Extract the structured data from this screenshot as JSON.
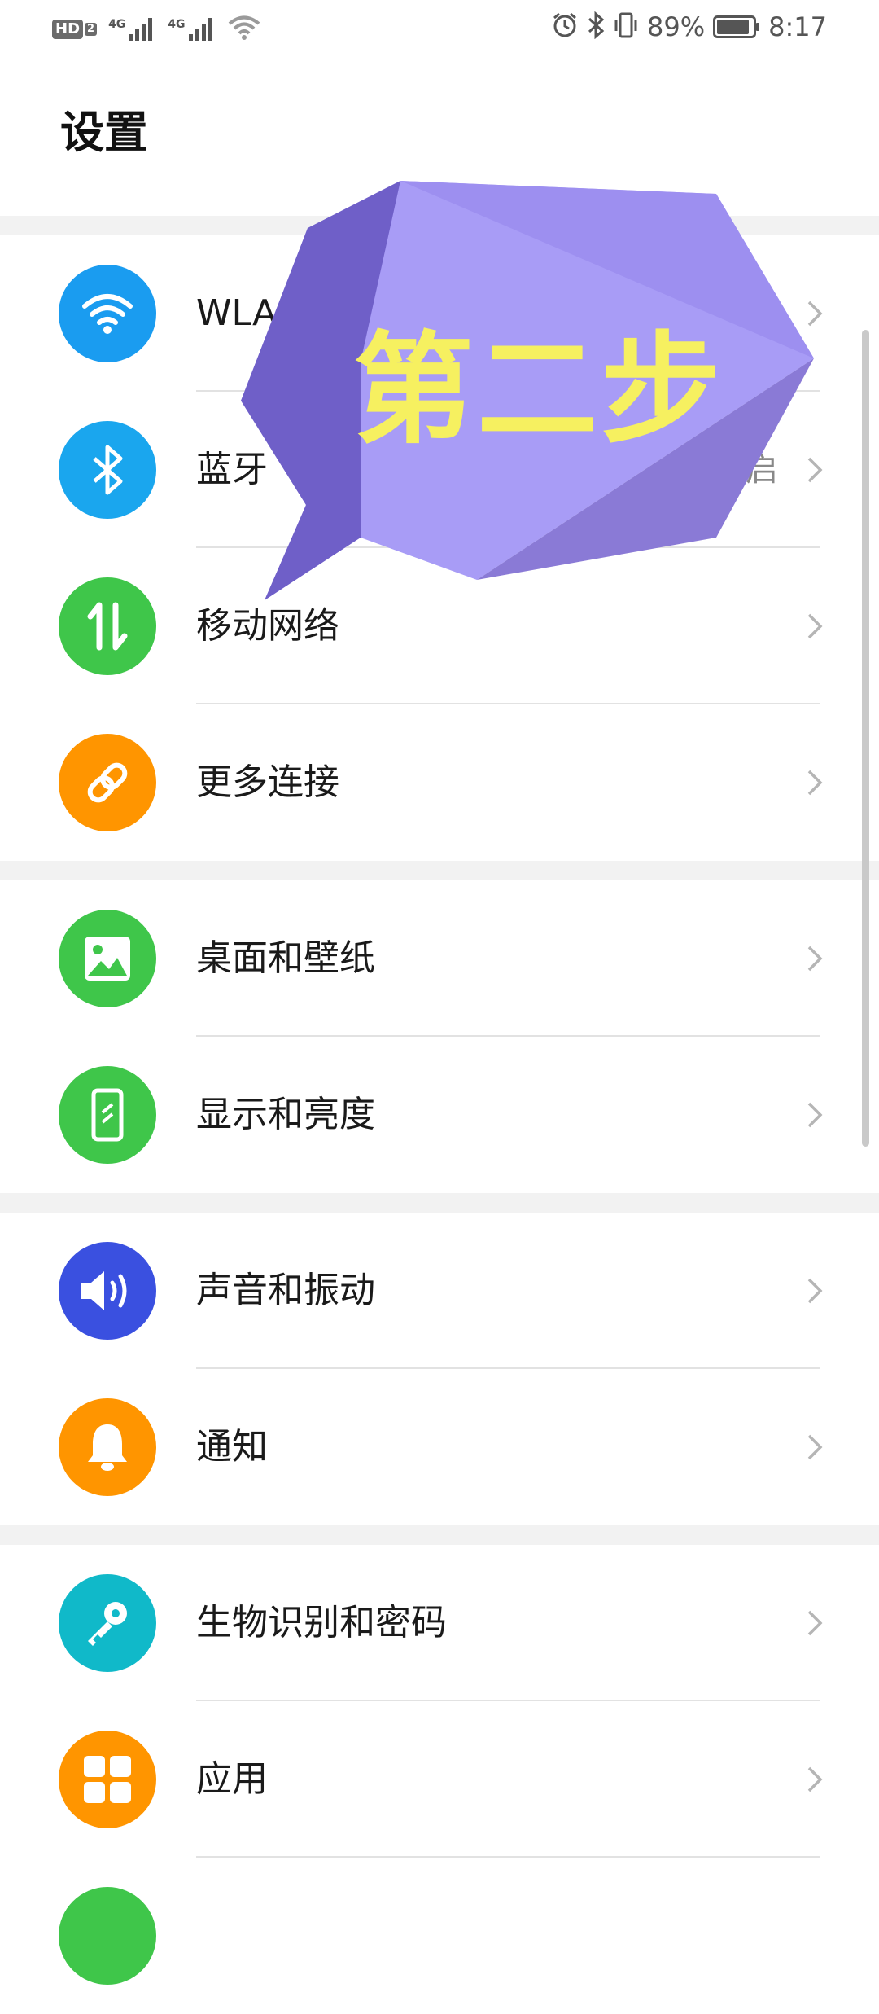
{
  "status_bar": {
    "hd_label": "HD",
    "hd_sub": "2",
    "sim1_label": "4G",
    "sim2_label": "4G",
    "battery_percent": "89%",
    "time": "8:17",
    "battery_level": 0.89
  },
  "page_title": "设置",
  "overlay": {
    "text": "第二步",
    "fill_color": "#a89cf6",
    "text_color": "#f6f060"
  },
  "groups": [
    {
      "items": [
        {
          "id": "wlan",
          "label": "WLAN",
          "value": "",
          "icon": "wifi-icon",
          "color": "#1a9cf0"
        },
        {
          "id": "bluetooth",
          "label": "蓝牙",
          "value": "已开启",
          "icon": "bluetooth-icon",
          "color": "#1aa6ee"
        },
        {
          "id": "mobile-network",
          "label": "移动网络",
          "value": "",
          "icon": "mobile-data-icon",
          "color": "#3fc64a"
        },
        {
          "id": "more-connections",
          "label": "更多连接",
          "value": "",
          "icon": "link-icon",
          "color": "#ff9500"
        }
      ]
    },
    {
      "items": [
        {
          "id": "wallpaper",
          "label": "桌面和壁纸",
          "value": "",
          "icon": "image-icon",
          "color": "#3fc64a"
        },
        {
          "id": "display",
          "label": "显示和亮度",
          "value": "",
          "icon": "phone-brightness-icon",
          "color": "#3fc64a"
        }
      ]
    },
    {
      "items": [
        {
          "id": "sound",
          "label": "声音和振动",
          "value": "",
          "icon": "speaker-icon",
          "color": "#3a50e0"
        },
        {
          "id": "notifications",
          "label": "通知",
          "value": "",
          "icon": "bell-icon",
          "color": "#ff9500"
        }
      ]
    },
    {
      "items": [
        {
          "id": "biometrics",
          "label": "生物识别和密码",
          "value": "",
          "icon": "key-icon",
          "color": "#10b9c9"
        },
        {
          "id": "apps",
          "label": "应用",
          "value": "",
          "icon": "apps-grid-icon",
          "color": "#ff9500"
        },
        {
          "id": "next-item",
          "label": "",
          "value": "",
          "icon": "partial-icon",
          "color": "#3fc64a"
        }
      ]
    }
  ]
}
